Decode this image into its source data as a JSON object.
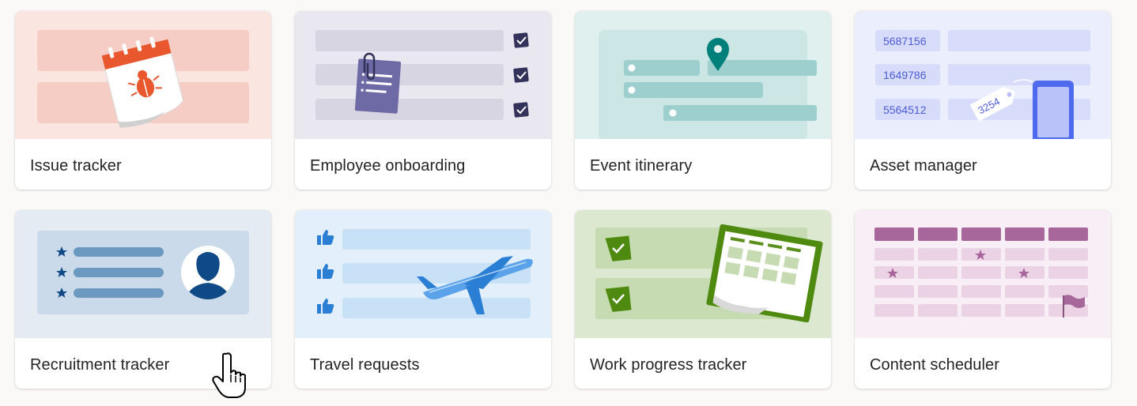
{
  "templates": [
    {
      "label": "Issue tracker",
      "icon": "calendar-bug-illustration",
      "bg": "#fbe5e1"
    },
    {
      "label": "Employee onboarding",
      "icon": "clipboard-checklist-illustration",
      "bg": "#e9e7ef"
    },
    {
      "label": "Event itinerary",
      "icon": "location-pin-illustration",
      "bg": "#e0f0ef"
    },
    {
      "label": "Asset manager",
      "icon": "asset-tag-phone-illustration",
      "bg": "#ebeefc"
    },
    {
      "label": "Recruitment tracker",
      "icon": "candidate-profile-illustration",
      "bg": "#e4ebf2"
    },
    {
      "label": "Travel requests",
      "icon": "airplane-illustration",
      "bg": "#e3f0fb"
    },
    {
      "label": "Work progress tracker",
      "icon": "calendar-progress-illustration",
      "bg": "#dde8d1"
    },
    {
      "label": "Content scheduler",
      "icon": "schedule-grid-illustration",
      "bg": "#f7eff5"
    }
  ],
  "asset_numbers": [
    "5687156",
    "1649786",
    "5564512"
  ],
  "asset_tag": "3254",
  "cursor": "hand-pointer-icon"
}
